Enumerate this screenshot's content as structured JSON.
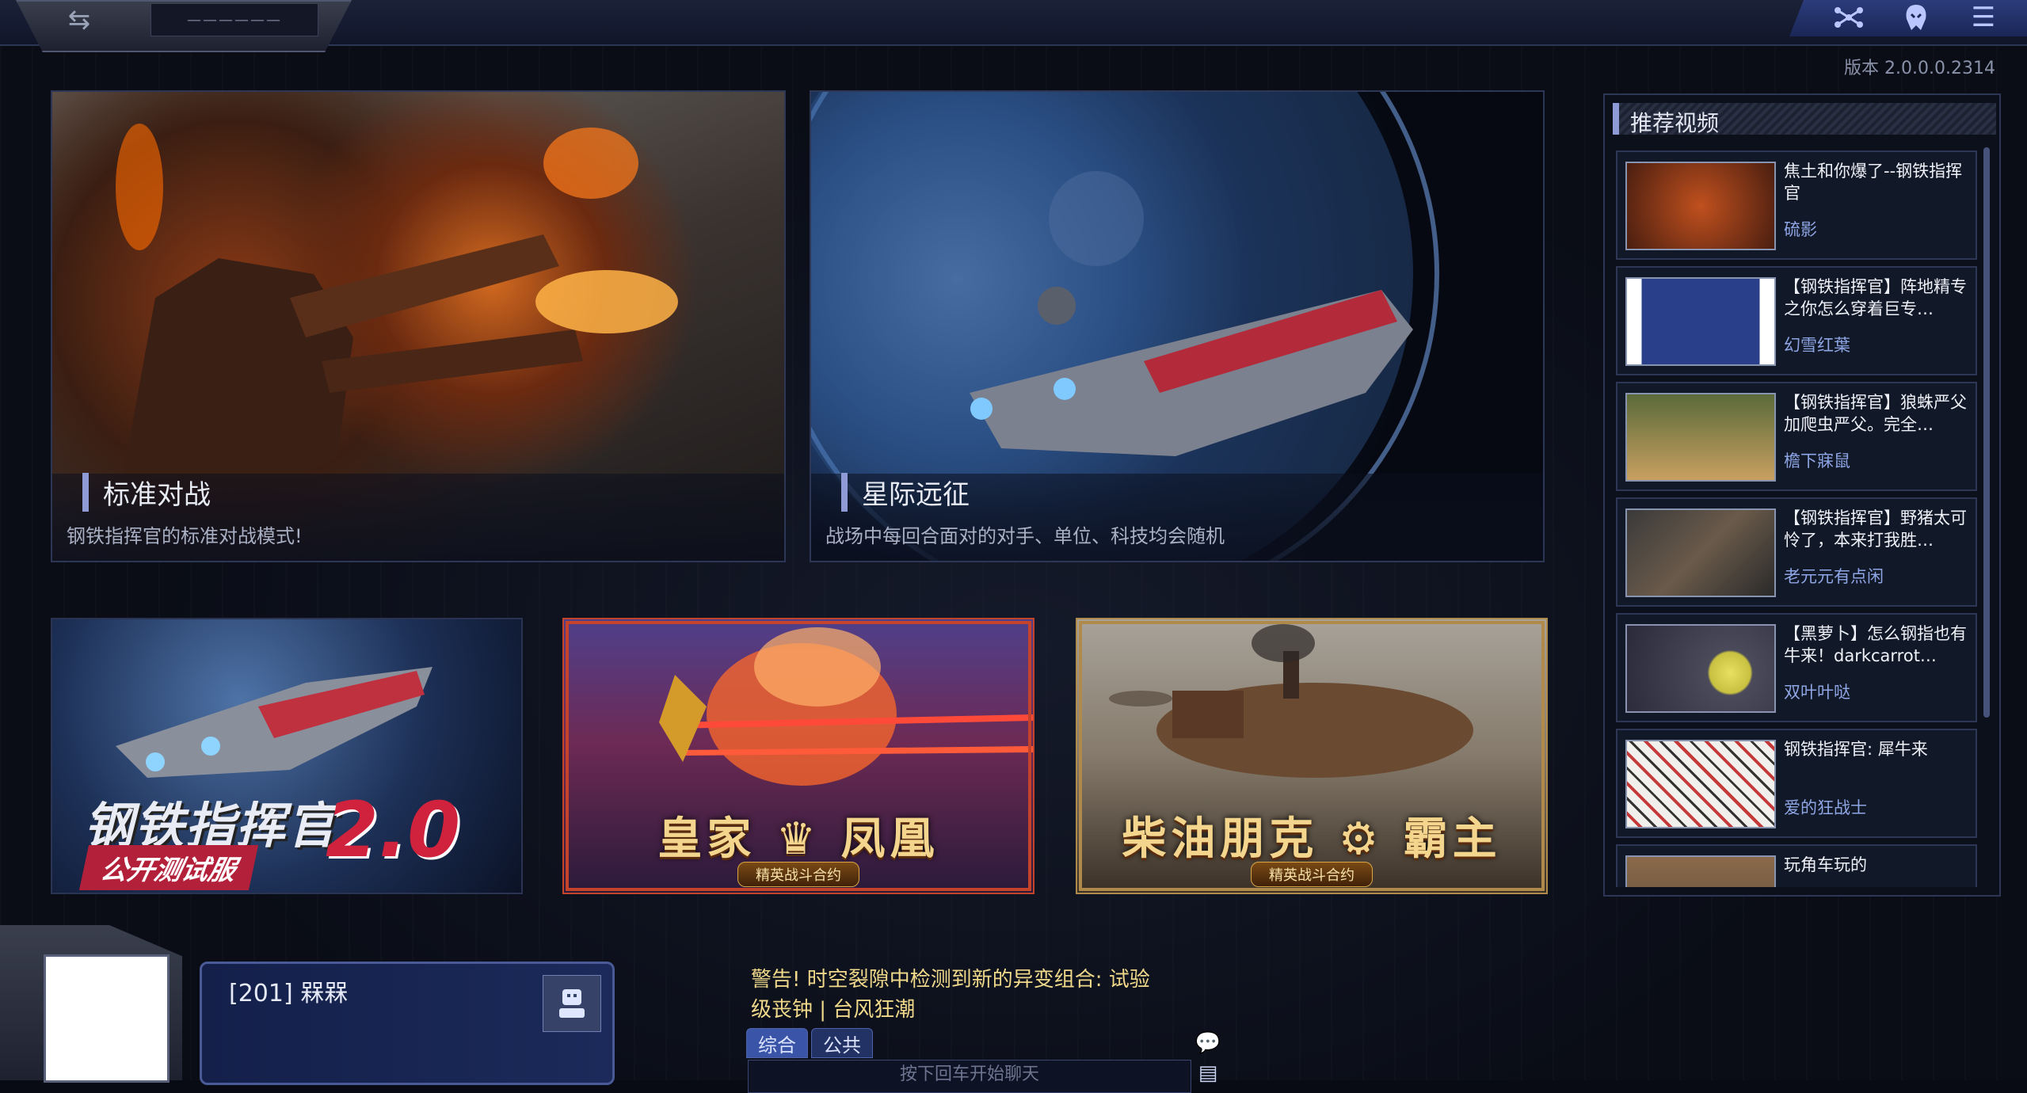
{
  "header": {
    "player_name_placeholder": "——————",
    "icons": [
      "swap-icon",
      "network-icon",
      "alien-icon",
      "menu-icon"
    ]
  },
  "version": "版本  2.0.0.0.2314",
  "modes": [
    {
      "title": "标准对战",
      "desc": "钢铁指挥官的标准对战模式!"
    },
    {
      "title": "星际远征",
      "desc": "战场中每回合面对的对手、单位、科技均会随机"
    }
  ],
  "banners": [
    {
      "line1": "钢铁指挥官",
      "line2": "公开测试服",
      "version": "2.0"
    },
    {
      "title": "皇家 ♛ 凤凰",
      "sub": "精英战斗合约"
    },
    {
      "title": "柴油朋克 ⚙ 霸主",
      "sub": "精英战斗合约"
    }
  ],
  "sidebar": {
    "title": "推荐视频",
    "videos": [
      {
        "title": "焦土和你爆了--钢铁指挥官",
        "author": "硫影"
      },
      {
        "title": "【钢铁指挥官】阵地精专之你怎么穿着巨专…",
        "author": "幻雪红葉"
      },
      {
        "title": "【钢铁指挥官】狼蛛严父加爬虫严父。完全…",
        "author": "檐下寐鼠"
      },
      {
        "title": "【钢铁指挥官】野猪太可怜了，本来打我胜…",
        "author": "老元元有点闲"
      },
      {
        "title": "【黑萝卜】怎么钢指也有牛来！darkcarrot…",
        "author": "双叶叶哒"
      },
      {
        "title": "钢铁指挥官: 犀牛来",
        "author": "爱的狂战士"
      },
      {
        "title": "玩角车玩的",
        "author": ""
      }
    ]
  },
  "player": {
    "name": "[201] 槑槑"
  },
  "chat": {
    "warning": "警告! 时空裂隙中检测到新的异变组合: 试验级丧钟 | 台风狂潮",
    "tabs": [
      "综合",
      "公共"
    ],
    "input_placeholder": "按下回车开始聊天"
  }
}
